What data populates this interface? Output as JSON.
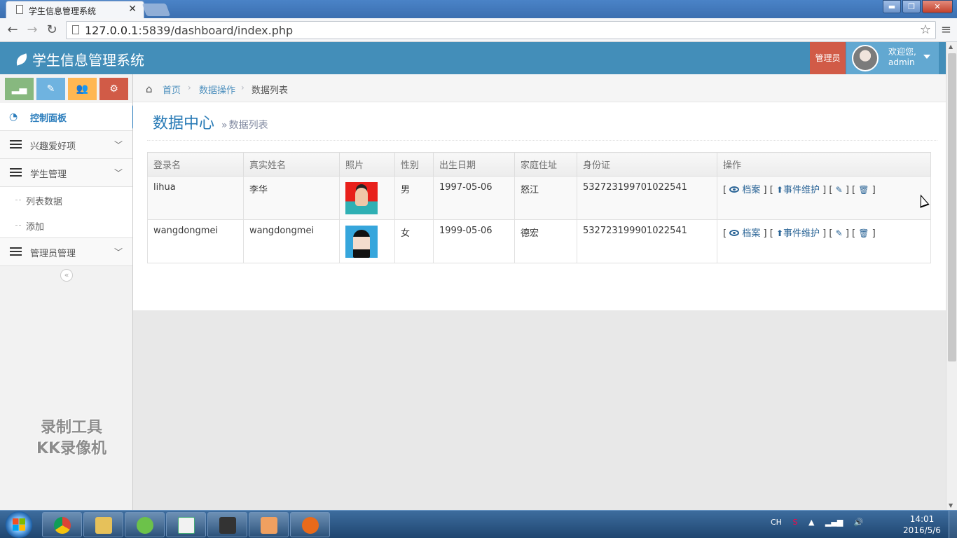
{
  "browser": {
    "tab_title": "学生信息管理系统",
    "tab_close": "✕",
    "url_host": "127.0.0.1",
    "url_rest": ":5839/dashboard/index.php",
    "window_buttons": [
      "▬",
      "❐",
      "✕"
    ]
  },
  "header": {
    "brand": "学生信息管理系统",
    "role": "管理员",
    "welcome": "欢迎您,",
    "username": "admin"
  },
  "sidebar": {
    "shortcuts": [
      {
        "icon": "signal-icon",
        "color": "#87b87f"
      },
      {
        "icon": "pencil-icon",
        "color": "#6fb3e0"
      },
      {
        "icon": "group-icon",
        "color": "#ffb752"
      },
      {
        "icon": "cogs-icon",
        "color": "#d15b47"
      }
    ],
    "items": [
      {
        "label": "控制面板",
        "icon": "dashboard-icon",
        "active": true
      },
      {
        "label": "兴趣爱好项",
        "icon": "list-icon"
      },
      {
        "label": "学生管理",
        "icon": "list-icon"
      },
      {
        "label": "管理员管理",
        "icon": "list-icon"
      }
    ],
    "student_sub": [
      "列表数据",
      "添加"
    ],
    "collapse": "«",
    "watermark_line1": "录制工具",
    "watermark_line2": "KK录像机"
  },
  "breadcrumbs": {
    "home": "首页",
    "section": "数据操作",
    "current": "数据列表",
    "separator": "›"
  },
  "page": {
    "title": "数据中心",
    "raquo": "»",
    "subtitle": "数据列表"
  },
  "table": {
    "headers": [
      "登录名",
      "真实姓名",
      "照片",
      "性别",
      "出生日期",
      "家庭住址",
      "身份证",
      "操作"
    ],
    "rows": [
      {
        "login": "lihua",
        "name": "李华",
        "gender": "男",
        "birth": "1997-05-06",
        "address": "怒江",
        "id_card": "532723199701022541"
      },
      {
        "login": "wangdongmei",
        "name": "wangdongmei",
        "gender": "女",
        "birth": "1999-05-06",
        "address": "德宏",
        "id_card": "532723199901022541"
      }
    ],
    "ops": {
      "archive": "档案",
      "event": "事件维护",
      "open": "[",
      "close": "]"
    }
  },
  "taskbar": {
    "tray_lang": "CH",
    "time": "14:01",
    "date": "2016/5/6"
  },
  "colors": {
    "header_bg": "#438eb9",
    "role_bg": "#d15b47",
    "link": "#2a6496",
    "title": "#2679b5"
  }
}
